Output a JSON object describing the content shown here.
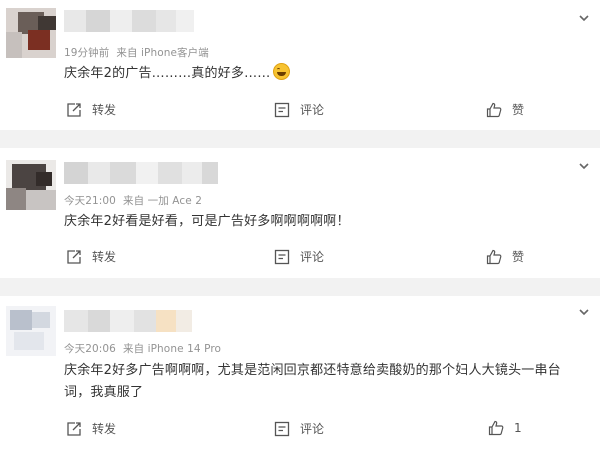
{
  "comments": [
    {
      "meta_time": "19分钟前",
      "meta_source": "来自 iPhone客户端",
      "content": "庆余年2的广告………真的好多……",
      "has_emoji": true,
      "repost_label": "转发",
      "comment_label": "评论",
      "like_label": "赞"
    },
    {
      "meta_time": "今天21:00",
      "meta_source": "来自 一加 Ace 2",
      "content": "庆余年2好看是好看，可是广告好多啊啊啊啊啊！",
      "repost_label": "转发",
      "comment_label": "评论",
      "like_label": "赞"
    },
    {
      "meta_time": "今天20:06",
      "meta_source": "来自 iPhone 14 Pro",
      "content": "庆余年2好多广告啊啊啊，尤其是范闲回京都还特意给卖酸奶的那个妇人大镜头一串台词，我真服了",
      "repost_label": "转发",
      "comment_label": "评论",
      "like_label": "1"
    }
  ],
  "icons": {
    "repost": "repost-icon",
    "comment": "comment-icon",
    "like": "thumbs-up-icon",
    "menu": "chevron-down-icon"
  },
  "colors": {
    "meta": "#939393",
    "text": "#333333",
    "action": "#555555",
    "separator": "#f2f2f2"
  }
}
